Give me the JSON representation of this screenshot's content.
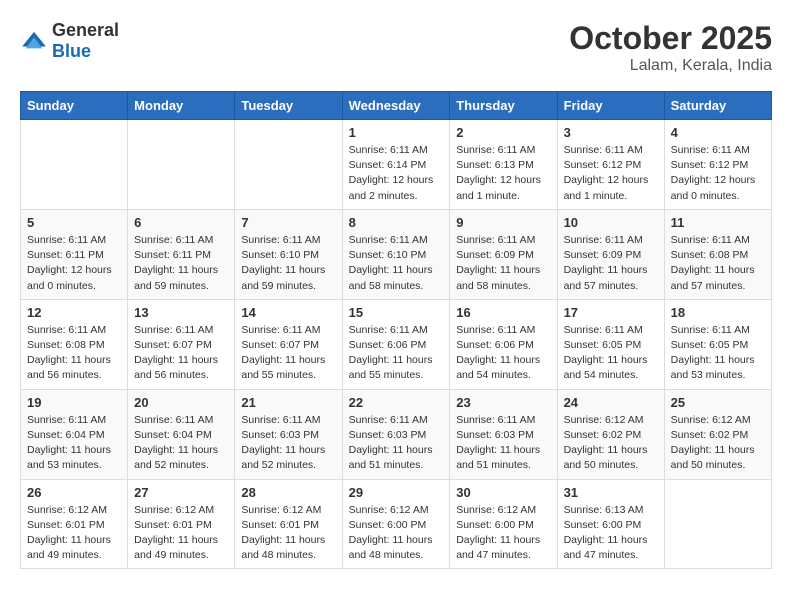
{
  "logo": {
    "general": "General",
    "blue": "Blue"
  },
  "header": {
    "month": "October 2025",
    "location": "Lalam, Kerala, India"
  },
  "weekdays": [
    "Sunday",
    "Monday",
    "Tuesday",
    "Wednesday",
    "Thursday",
    "Friday",
    "Saturday"
  ],
  "weeks": [
    [
      {
        "day": "",
        "info": ""
      },
      {
        "day": "",
        "info": ""
      },
      {
        "day": "",
        "info": ""
      },
      {
        "day": "1",
        "info": "Sunrise: 6:11 AM\nSunset: 6:14 PM\nDaylight: 12 hours\nand 2 minutes."
      },
      {
        "day": "2",
        "info": "Sunrise: 6:11 AM\nSunset: 6:13 PM\nDaylight: 12 hours\nand 1 minute."
      },
      {
        "day": "3",
        "info": "Sunrise: 6:11 AM\nSunset: 6:12 PM\nDaylight: 12 hours\nand 1 minute."
      },
      {
        "day": "4",
        "info": "Sunrise: 6:11 AM\nSunset: 6:12 PM\nDaylight: 12 hours\nand 0 minutes."
      }
    ],
    [
      {
        "day": "5",
        "info": "Sunrise: 6:11 AM\nSunset: 6:11 PM\nDaylight: 12 hours\nand 0 minutes."
      },
      {
        "day": "6",
        "info": "Sunrise: 6:11 AM\nSunset: 6:11 PM\nDaylight: 11 hours\nand 59 minutes."
      },
      {
        "day": "7",
        "info": "Sunrise: 6:11 AM\nSunset: 6:10 PM\nDaylight: 11 hours\nand 59 minutes."
      },
      {
        "day": "8",
        "info": "Sunrise: 6:11 AM\nSunset: 6:10 PM\nDaylight: 11 hours\nand 58 minutes."
      },
      {
        "day": "9",
        "info": "Sunrise: 6:11 AM\nSunset: 6:09 PM\nDaylight: 11 hours\nand 58 minutes."
      },
      {
        "day": "10",
        "info": "Sunrise: 6:11 AM\nSunset: 6:09 PM\nDaylight: 11 hours\nand 57 minutes."
      },
      {
        "day": "11",
        "info": "Sunrise: 6:11 AM\nSunset: 6:08 PM\nDaylight: 11 hours\nand 57 minutes."
      }
    ],
    [
      {
        "day": "12",
        "info": "Sunrise: 6:11 AM\nSunset: 6:08 PM\nDaylight: 11 hours\nand 56 minutes."
      },
      {
        "day": "13",
        "info": "Sunrise: 6:11 AM\nSunset: 6:07 PM\nDaylight: 11 hours\nand 56 minutes."
      },
      {
        "day": "14",
        "info": "Sunrise: 6:11 AM\nSunset: 6:07 PM\nDaylight: 11 hours\nand 55 minutes."
      },
      {
        "day": "15",
        "info": "Sunrise: 6:11 AM\nSunset: 6:06 PM\nDaylight: 11 hours\nand 55 minutes."
      },
      {
        "day": "16",
        "info": "Sunrise: 6:11 AM\nSunset: 6:06 PM\nDaylight: 11 hours\nand 54 minutes."
      },
      {
        "day": "17",
        "info": "Sunrise: 6:11 AM\nSunset: 6:05 PM\nDaylight: 11 hours\nand 54 minutes."
      },
      {
        "day": "18",
        "info": "Sunrise: 6:11 AM\nSunset: 6:05 PM\nDaylight: 11 hours\nand 53 minutes."
      }
    ],
    [
      {
        "day": "19",
        "info": "Sunrise: 6:11 AM\nSunset: 6:04 PM\nDaylight: 11 hours\nand 53 minutes."
      },
      {
        "day": "20",
        "info": "Sunrise: 6:11 AM\nSunset: 6:04 PM\nDaylight: 11 hours\nand 52 minutes."
      },
      {
        "day": "21",
        "info": "Sunrise: 6:11 AM\nSunset: 6:03 PM\nDaylight: 11 hours\nand 52 minutes."
      },
      {
        "day": "22",
        "info": "Sunrise: 6:11 AM\nSunset: 6:03 PM\nDaylight: 11 hours\nand 51 minutes."
      },
      {
        "day": "23",
        "info": "Sunrise: 6:11 AM\nSunset: 6:03 PM\nDaylight: 11 hours\nand 51 minutes."
      },
      {
        "day": "24",
        "info": "Sunrise: 6:12 AM\nSunset: 6:02 PM\nDaylight: 11 hours\nand 50 minutes."
      },
      {
        "day": "25",
        "info": "Sunrise: 6:12 AM\nSunset: 6:02 PM\nDaylight: 11 hours\nand 50 minutes."
      }
    ],
    [
      {
        "day": "26",
        "info": "Sunrise: 6:12 AM\nSunset: 6:01 PM\nDaylight: 11 hours\nand 49 minutes."
      },
      {
        "day": "27",
        "info": "Sunrise: 6:12 AM\nSunset: 6:01 PM\nDaylight: 11 hours\nand 49 minutes."
      },
      {
        "day": "28",
        "info": "Sunrise: 6:12 AM\nSunset: 6:01 PM\nDaylight: 11 hours\nand 48 minutes."
      },
      {
        "day": "29",
        "info": "Sunrise: 6:12 AM\nSunset: 6:00 PM\nDaylight: 11 hours\nand 48 minutes."
      },
      {
        "day": "30",
        "info": "Sunrise: 6:12 AM\nSunset: 6:00 PM\nDaylight: 11 hours\nand 47 minutes."
      },
      {
        "day": "31",
        "info": "Sunrise: 6:13 AM\nSunset: 6:00 PM\nDaylight: 11 hours\nand 47 minutes."
      },
      {
        "day": "",
        "info": ""
      }
    ]
  ]
}
